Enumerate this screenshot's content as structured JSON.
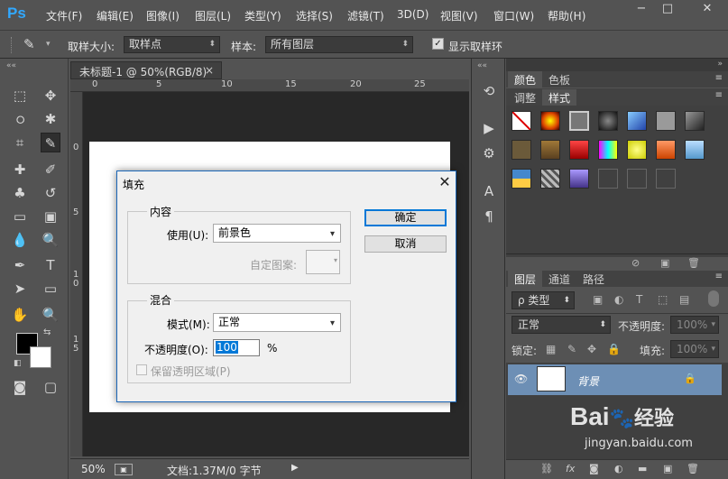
{
  "menubar": {
    "logo": "Ps",
    "items": [
      "文件(F)",
      "编辑(E)",
      "图像(I)",
      "图层(L)",
      "类型(Y)",
      "选择(S)",
      "滤镜(T)",
      "3D(D)",
      "视图(V)",
      "窗口(W)",
      "帮助(H)"
    ],
    "window_buttons": [
      "−",
      "□",
      "✕"
    ]
  },
  "options": {
    "sample_size_label": "取样大小:",
    "sample_size_value": "取样点",
    "sample_label": "样本:",
    "sample_value": "所有图层",
    "show_ring_label": "显示取样环",
    "show_ring_checked": true
  },
  "document": {
    "tab_title": "未标题-1 @ 50%(RGB/8)",
    "tab_close": "×",
    "ruler_h": [
      "0",
      "5",
      "10",
      "15",
      "20",
      "25"
    ],
    "ruler_v": [
      "0",
      "5",
      "1\n0",
      "1\n5"
    ],
    "zoom": "50%",
    "doc_info": "文档:1.37M/0 字节"
  },
  "dialog": {
    "title": "填充",
    "close": "✕",
    "content_group": "内容",
    "use_label": "使用(U):",
    "use_value": "前景色",
    "pattern_label": "自定图案:",
    "blend_group": "混合",
    "mode_label": "模式(M):",
    "mode_value": "正常",
    "opacity_label": "不透明度(O):",
    "opacity_value": "100",
    "opacity_unit": "%",
    "preserve_label": "保留透明区域(P)",
    "ok_label": "确定",
    "cancel_label": "取消"
  },
  "panels": {
    "tabs_top": [
      "颜色",
      "色板"
    ],
    "tabs_second": [
      "调整",
      "样式"
    ],
    "tabs_layers": [
      "图层",
      "通道",
      "路径"
    ],
    "kind_filter": "ρ 类型",
    "blend_mode": "正常",
    "opacity_label": "不透明度:",
    "opacity_value": "100%",
    "lock_label": "锁定:",
    "fill_label": "填充:",
    "fill_value": "100%",
    "layer_name": "背景"
  },
  "watermark": {
    "brand": "Bai",
    "brand2": "经验",
    "url": "jingyan.baidu.com"
  },
  "colors": {
    "accent": "#31a8ff",
    "dialog_border": "#1b66b7",
    "selection": "#0078d7",
    "layer_selected": "#6d8fb5"
  }
}
